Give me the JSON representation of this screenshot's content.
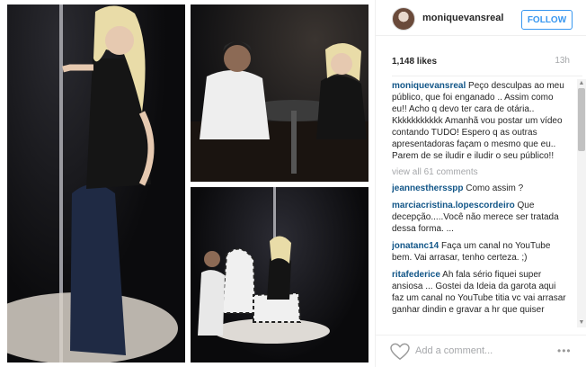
{
  "post": {
    "username": "moniquevansreal",
    "follow_label": "FOLLOW",
    "likes": "1,148 likes",
    "time": "13h",
    "caption_user": "moniquevansreal",
    "caption_text": "Peço desculpas ao meu público, que foi enganado .. Assim como eu!! Acho q devo ter cara de otária.. Kkkkkkkkkkk Amanhã vou postar um vídeo contando TUDO! Espero q as outras apresentadoras façam o mesmo que eu.. Parem de se iludir e iludir o seu público!!",
    "view_all": "view all 61 comments",
    "add_comment_placeholder": "Add a comment...",
    "more_label": "•••"
  },
  "comments": [
    {
      "user": "jeannesthersspp",
      "text": "Como assim ?"
    },
    {
      "user": "marciacristina.lopescordeiro",
      "text": "Que decepção.....Você não merece ser tratada dessa forma. ..."
    },
    {
      "user": "jonatanc14",
      "text": "Faça um canal no YouTube bem. Vai arrasar, tenho certeza. ;)"
    },
    {
      "user": "ritafederice",
      "text": "Ah fala sério fiquei super ansiosa ... Gostei da Ideia da garota aqui faz um canal no YouTube titia vc vai arrasar ganhar dindin e gravar a hr que quiser"
    }
  ],
  "colors": {
    "link": "#125688",
    "follow": "#3897f0",
    "muted": "#a5a7aa"
  },
  "icons": {
    "like": "heart-icon",
    "more": "ellipsis-icon"
  }
}
